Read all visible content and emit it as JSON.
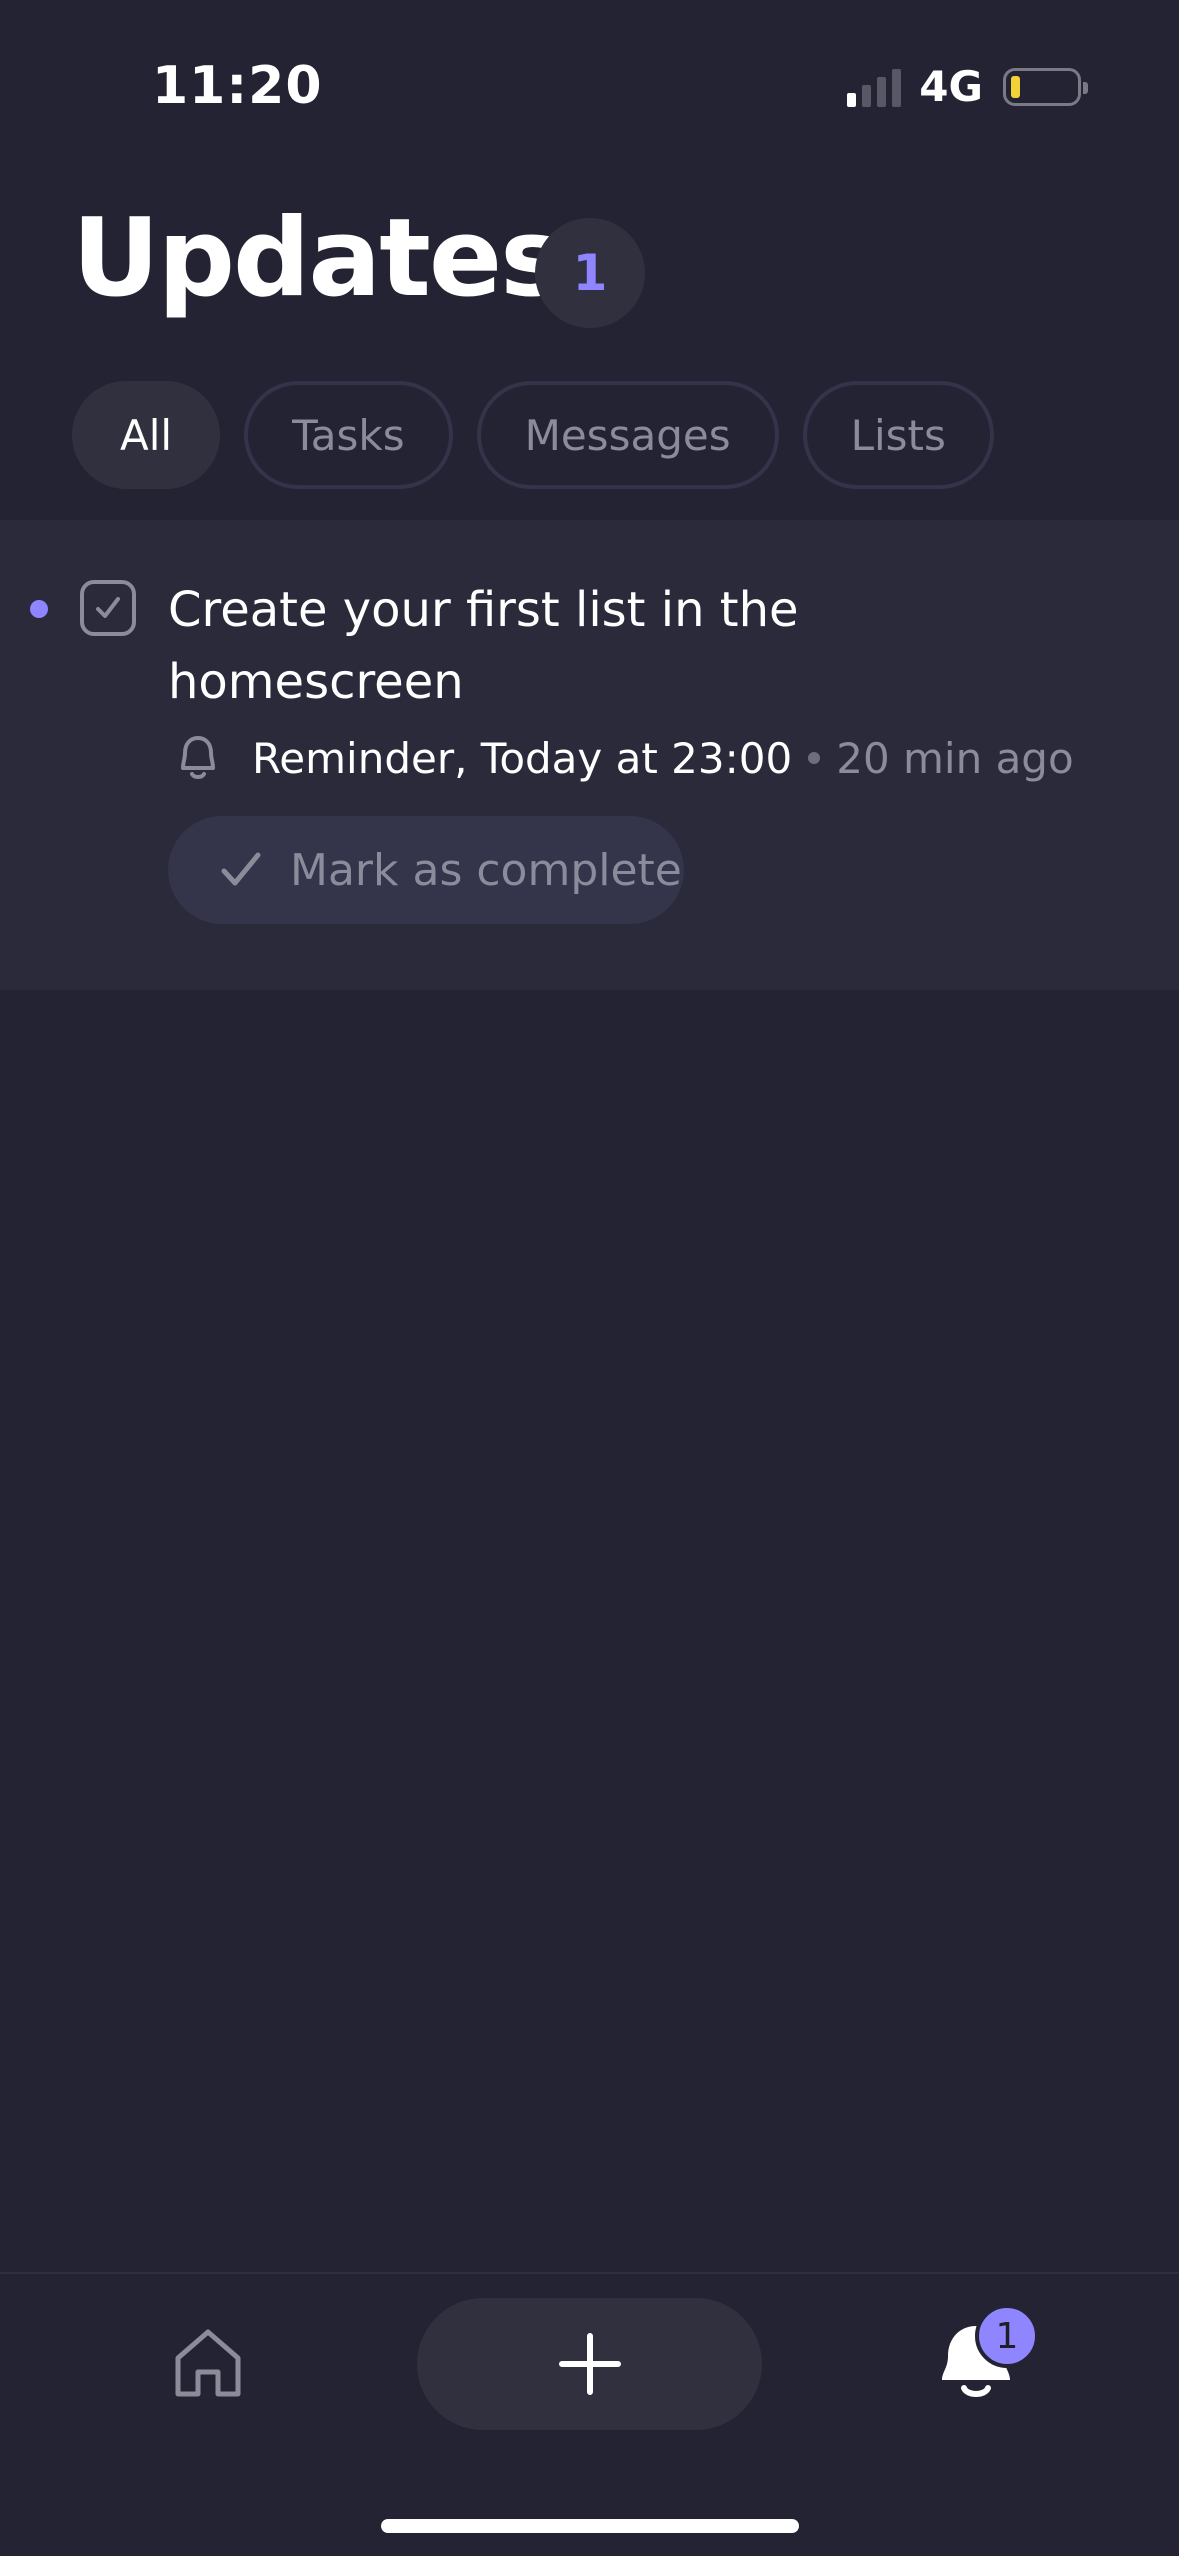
{
  "status_bar": {
    "time": "11:20",
    "network": "4G",
    "signal_bars_filled": 1,
    "signal_bars_total": 4,
    "battery_level": 0.1,
    "battery_color": "#f2d337"
  },
  "header": {
    "title": "Updates",
    "count": "1"
  },
  "filters": {
    "tabs": [
      {
        "label": "All",
        "active": true
      },
      {
        "label": "Tasks",
        "active": false
      },
      {
        "label": "Messages",
        "active": false
      },
      {
        "label": "Lists",
        "active": false
      }
    ]
  },
  "updates": [
    {
      "title": "Create your first list in the homescreen",
      "meta_label": "Reminder, Today at 23:00",
      "time_ago": "20 min ago",
      "action_label": "Mark as complete",
      "unread": true
    }
  ],
  "bottom_nav": {
    "items": [
      "home-icon",
      "plus-icon",
      "bell-icon"
    ],
    "notification_count": "1"
  },
  "colors": {
    "background": "#232333",
    "card": "#2a2a3b",
    "accent": "#8f85ff",
    "muted_text": "#8b8b9c"
  }
}
